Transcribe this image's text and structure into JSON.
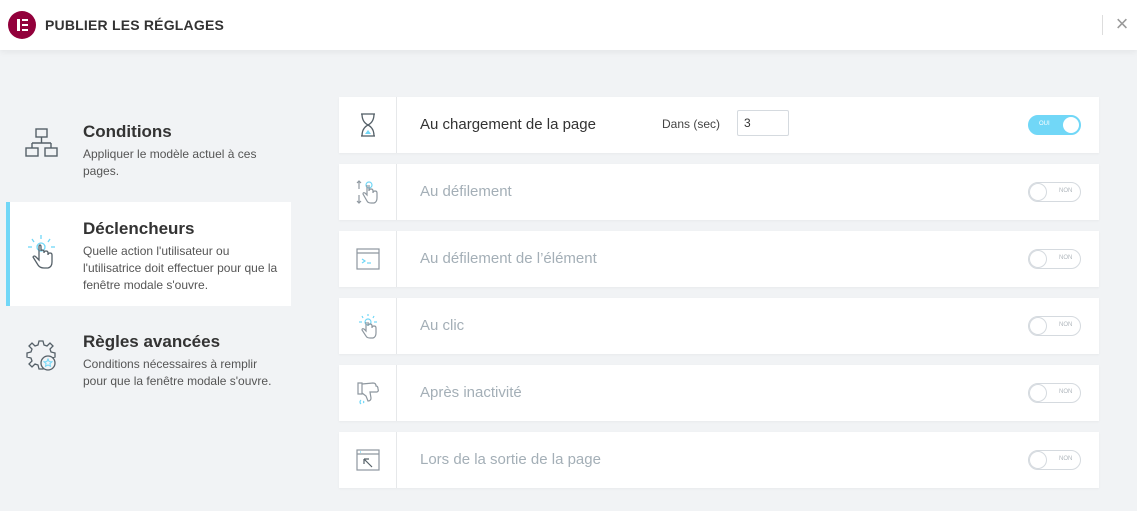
{
  "header": {
    "title": "PUBLIER LES RÉGLAGES",
    "logo": "elementor-logo",
    "close_icon": "×"
  },
  "colors": {
    "accent": "#71d7f7",
    "brand": "#92003b",
    "background": "#f1f3f5"
  },
  "sidebar": {
    "tabs": [
      {
        "title": "Conditions",
        "desc": "Appliquer le modèle actuel à ces pages.",
        "icon": "sitemap-icon",
        "active": false
      },
      {
        "title": "Déclencheurs",
        "desc": "Quelle action l'utilisateur ou l'utilisatrice doit effectuer pour que la fenêtre modale s'ouvre.",
        "icon": "hand-click-icon",
        "active": true
      },
      {
        "title": "Règles avancées",
        "desc": "Conditions nécessaires à remplir pour que la fenêtre modale s'ouvre.",
        "icon": "gears-icon",
        "active": false
      }
    ]
  },
  "triggers": {
    "rows": [
      {
        "label": "Au chargement de la page",
        "icon": "hourglass-icon",
        "enabled": true,
        "toggle_text": "OUI",
        "sec_label": "Dans (sec)",
        "sec_value": "3"
      },
      {
        "label": "Au défilement",
        "icon": "scroll-hand-icon",
        "enabled": false,
        "toggle_text": "NON"
      },
      {
        "label": "Au défilement de l’élément",
        "icon": "terminal-window-icon",
        "enabled": false,
        "toggle_text": "NON"
      },
      {
        "label": "Au clic",
        "icon": "click-hand-icon",
        "enabled": false,
        "toggle_text": "NON"
      },
      {
        "label": "Après inactivité",
        "icon": "idle-hand-icon",
        "enabled": false,
        "toggle_text": "NON"
      },
      {
        "label": "Lors de la sortie de la page",
        "icon": "exit-window-icon",
        "enabled": false,
        "toggle_text": "NON"
      }
    ]
  }
}
